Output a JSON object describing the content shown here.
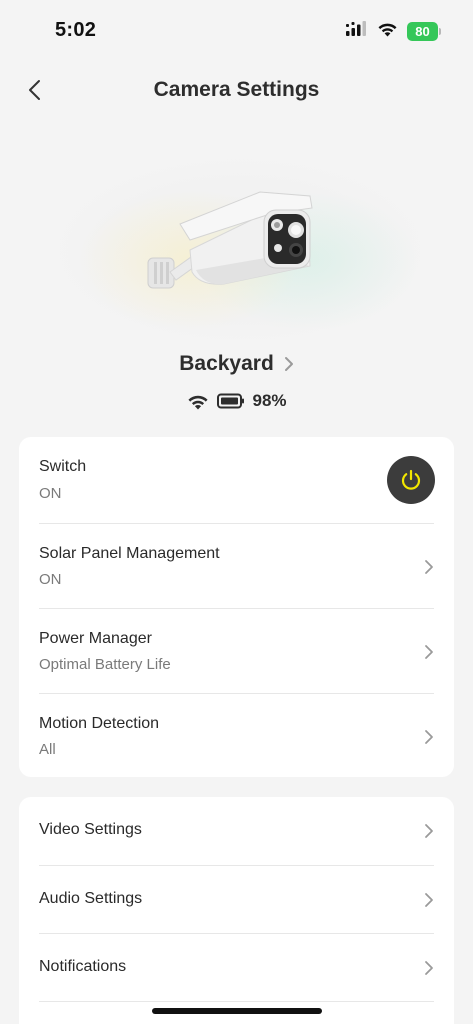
{
  "status_bar": {
    "time": "5:02",
    "battery": "80"
  },
  "nav": {
    "title": "Camera Settings"
  },
  "device": {
    "name": "Backyard",
    "battery_pct": "98%"
  },
  "settings_primary": [
    {
      "title": "Switch",
      "value": "ON"
    },
    {
      "title": "Solar Panel Management",
      "value": "ON"
    },
    {
      "title": "Power Manager",
      "value": "Optimal Battery Life"
    },
    {
      "title": "Motion Detection",
      "value": "All"
    }
  ],
  "settings_secondary": [
    {
      "title": "Video Settings"
    },
    {
      "title": "Audio Settings"
    },
    {
      "title": "Notifications"
    }
  ],
  "colors": {
    "background": "#f4f4f4",
    "card": "#ffffff",
    "power_button_bg": "#3c3c3c",
    "power_icon": "#f2e600",
    "battery_green": "#35c759"
  },
  "icons": [
    "signal-icon",
    "wifi-icon",
    "back-chevron-icon",
    "chevron-right-icon",
    "power-icon",
    "battery-icon"
  ]
}
